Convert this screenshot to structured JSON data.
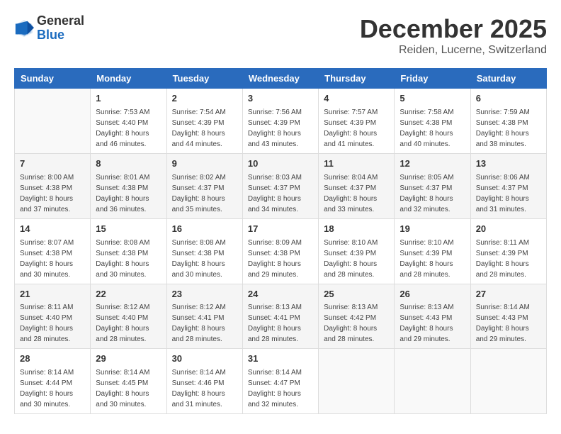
{
  "logo": {
    "general": "General",
    "blue": "Blue"
  },
  "header": {
    "month": "December 2025",
    "location": "Reiden, Lucerne, Switzerland"
  },
  "weekdays": [
    "Sunday",
    "Monday",
    "Tuesday",
    "Wednesday",
    "Thursday",
    "Friday",
    "Saturday"
  ],
  "weeks": [
    [
      {
        "day": "",
        "sunrise": "",
        "sunset": "",
        "daylight": ""
      },
      {
        "day": "1",
        "sunrise": "Sunrise: 7:53 AM",
        "sunset": "Sunset: 4:40 PM",
        "daylight": "Daylight: 8 hours and 46 minutes."
      },
      {
        "day": "2",
        "sunrise": "Sunrise: 7:54 AM",
        "sunset": "Sunset: 4:39 PM",
        "daylight": "Daylight: 8 hours and 44 minutes."
      },
      {
        "day": "3",
        "sunrise": "Sunrise: 7:56 AM",
        "sunset": "Sunset: 4:39 PM",
        "daylight": "Daylight: 8 hours and 43 minutes."
      },
      {
        "day": "4",
        "sunrise": "Sunrise: 7:57 AM",
        "sunset": "Sunset: 4:39 PM",
        "daylight": "Daylight: 8 hours and 41 minutes."
      },
      {
        "day": "5",
        "sunrise": "Sunrise: 7:58 AM",
        "sunset": "Sunset: 4:38 PM",
        "daylight": "Daylight: 8 hours and 40 minutes."
      },
      {
        "day": "6",
        "sunrise": "Sunrise: 7:59 AM",
        "sunset": "Sunset: 4:38 PM",
        "daylight": "Daylight: 8 hours and 38 minutes."
      }
    ],
    [
      {
        "day": "7",
        "sunrise": "Sunrise: 8:00 AM",
        "sunset": "Sunset: 4:38 PM",
        "daylight": "Daylight: 8 hours and 37 minutes."
      },
      {
        "day": "8",
        "sunrise": "Sunrise: 8:01 AM",
        "sunset": "Sunset: 4:38 PM",
        "daylight": "Daylight: 8 hours and 36 minutes."
      },
      {
        "day": "9",
        "sunrise": "Sunrise: 8:02 AM",
        "sunset": "Sunset: 4:37 PM",
        "daylight": "Daylight: 8 hours and 35 minutes."
      },
      {
        "day": "10",
        "sunrise": "Sunrise: 8:03 AM",
        "sunset": "Sunset: 4:37 PM",
        "daylight": "Daylight: 8 hours and 34 minutes."
      },
      {
        "day": "11",
        "sunrise": "Sunrise: 8:04 AM",
        "sunset": "Sunset: 4:37 PM",
        "daylight": "Daylight: 8 hours and 33 minutes."
      },
      {
        "day": "12",
        "sunrise": "Sunrise: 8:05 AM",
        "sunset": "Sunset: 4:37 PM",
        "daylight": "Daylight: 8 hours and 32 minutes."
      },
      {
        "day": "13",
        "sunrise": "Sunrise: 8:06 AM",
        "sunset": "Sunset: 4:37 PM",
        "daylight": "Daylight: 8 hours and 31 minutes."
      }
    ],
    [
      {
        "day": "14",
        "sunrise": "Sunrise: 8:07 AM",
        "sunset": "Sunset: 4:38 PM",
        "daylight": "Daylight: 8 hours and 30 minutes."
      },
      {
        "day": "15",
        "sunrise": "Sunrise: 8:08 AM",
        "sunset": "Sunset: 4:38 PM",
        "daylight": "Daylight: 8 hours and 30 minutes."
      },
      {
        "day": "16",
        "sunrise": "Sunrise: 8:08 AM",
        "sunset": "Sunset: 4:38 PM",
        "daylight": "Daylight: 8 hours and 30 minutes."
      },
      {
        "day": "17",
        "sunrise": "Sunrise: 8:09 AM",
        "sunset": "Sunset: 4:38 PM",
        "daylight": "Daylight: 8 hours and 29 minutes."
      },
      {
        "day": "18",
        "sunrise": "Sunrise: 8:10 AM",
        "sunset": "Sunset: 4:39 PM",
        "daylight": "Daylight: 8 hours and 28 minutes."
      },
      {
        "day": "19",
        "sunrise": "Sunrise: 8:10 AM",
        "sunset": "Sunset: 4:39 PM",
        "daylight": "Daylight: 8 hours and 28 minutes."
      },
      {
        "day": "20",
        "sunrise": "Sunrise: 8:11 AM",
        "sunset": "Sunset: 4:39 PM",
        "daylight": "Daylight: 8 hours and 28 minutes."
      }
    ],
    [
      {
        "day": "21",
        "sunrise": "Sunrise: 8:11 AM",
        "sunset": "Sunset: 4:40 PM",
        "daylight": "Daylight: 8 hours and 28 minutes."
      },
      {
        "day": "22",
        "sunrise": "Sunrise: 8:12 AM",
        "sunset": "Sunset: 4:40 PM",
        "daylight": "Daylight: 8 hours and 28 minutes."
      },
      {
        "day": "23",
        "sunrise": "Sunrise: 8:12 AM",
        "sunset": "Sunset: 4:41 PM",
        "daylight": "Daylight: 8 hours and 28 minutes."
      },
      {
        "day": "24",
        "sunrise": "Sunrise: 8:13 AM",
        "sunset": "Sunset: 4:41 PM",
        "daylight": "Daylight: 8 hours and 28 minutes."
      },
      {
        "day": "25",
        "sunrise": "Sunrise: 8:13 AM",
        "sunset": "Sunset: 4:42 PM",
        "daylight": "Daylight: 8 hours and 28 minutes."
      },
      {
        "day": "26",
        "sunrise": "Sunrise: 8:13 AM",
        "sunset": "Sunset: 4:43 PM",
        "daylight": "Daylight: 8 hours and 29 minutes."
      },
      {
        "day": "27",
        "sunrise": "Sunrise: 8:14 AM",
        "sunset": "Sunset: 4:43 PM",
        "daylight": "Daylight: 8 hours and 29 minutes."
      }
    ],
    [
      {
        "day": "28",
        "sunrise": "Sunrise: 8:14 AM",
        "sunset": "Sunset: 4:44 PM",
        "daylight": "Daylight: 8 hours and 30 minutes."
      },
      {
        "day": "29",
        "sunrise": "Sunrise: 8:14 AM",
        "sunset": "Sunset: 4:45 PM",
        "daylight": "Daylight: 8 hours and 30 minutes."
      },
      {
        "day": "30",
        "sunrise": "Sunrise: 8:14 AM",
        "sunset": "Sunset: 4:46 PM",
        "daylight": "Daylight: 8 hours and 31 minutes."
      },
      {
        "day": "31",
        "sunrise": "Sunrise: 8:14 AM",
        "sunset": "Sunset: 4:47 PM",
        "daylight": "Daylight: 8 hours and 32 minutes."
      },
      {
        "day": "",
        "sunrise": "",
        "sunset": "",
        "daylight": ""
      },
      {
        "day": "",
        "sunrise": "",
        "sunset": "",
        "daylight": ""
      },
      {
        "day": "",
        "sunrise": "",
        "sunset": "",
        "daylight": ""
      }
    ]
  ]
}
